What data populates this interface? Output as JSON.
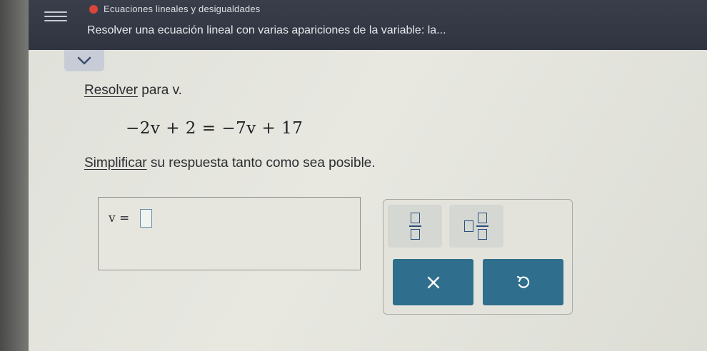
{
  "header": {
    "topic": "Ecuaciones lineales y desigualdades",
    "lesson": "Resolver una ecuación lineal con varias apariciones de la variable: la..."
  },
  "problem": {
    "prompt_link": "Resolver",
    "prompt_rest": " para v.",
    "equation": "−2v + 2 = −7v + 17",
    "instruction_link": "Simplificar",
    "instruction_rest": " su respuesta tanto como sea posible."
  },
  "answer": {
    "label": "v ="
  },
  "keypad": {
    "keys": [
      "fraction-key",
      "mixed-number-key"
    ],
    "clear_icon": "x-icon",
    "undo_icon": "undo-icon"
  },
  "colors": {
    "header_bg": "#2f3440",
    "action_button": "#2f6e8c",
    "topic_dot": "#d9453b"
  }
}
